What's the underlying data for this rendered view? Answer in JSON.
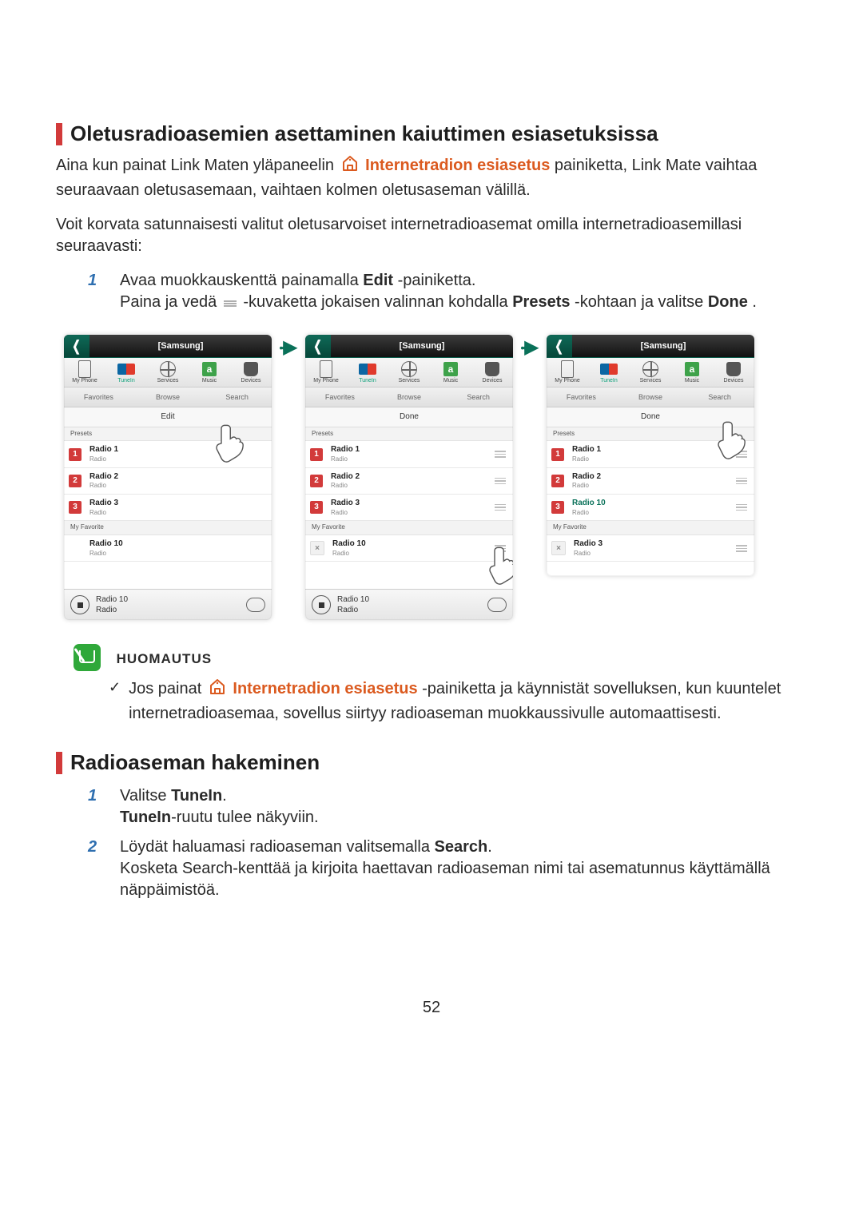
{
  "page_number": "52",
  "section1": {
    "heading": "Oletusradioasemien asettaminen kaiuttimen esiasetuksissa",
    "intro_part1": "Aina kun painat Link Maten yläpaneelin ",
    "intro_accent": "Internetradion esiasetus",
    "intro_part2": " painiketta, Link Mate vaihtaa seuraavaan oletusasemaan, vaihtaen kolmen oletusaseman välillä.",
    "intro2": "Voit korvata satunnaisesti valitut oletusarvoiset internetradioasemat omilla internetradioasemillasi seuraavasti:",
    "step1_num": "1",
    "step1_a_pre": "Avaa muokkauskenttä painamalla ",
    "step1_a_bold": "Edit",
    "step1_a_post": "-painiketta.",
    "step1_b_pre": "Paina ja vedä ",
    "step1_b_mid": " -kuvaketta jokaisen valinnan kohdalla ",
    "step1_b_bold1": "Presets",
    "step1_b_post1": "-kohtaan ja valitse ",
    "step1_b_bold2": "Done",
    "step1_b_post2": "."
  },
  "note": {
    "title": "HUOMAUTUS",
    "item_pre": "Jos painat ",
    "item_accent": "Internetradion esiasetus",
    "item_post": " -painiketta ja käynnistät sovelluksen, kun kuuntelet internetradioasemaa, sovellus siirtyy radioaseman muokkaussivulle automaattisesti."
  },
  "section2": {
    "heading": "Radioaseman hakeminen",
    "step1_num": "1",
    "step1_line1_pre": "Valitse ",
    "step1_line1_bold": "TuneIn",
    "step1_line1_post": ".",
    "step1_line2_bold": "TuneIn",
    "step1_line2_post": "-ruutu tulee näkyviin.",
    "step2_num": "2",
    "step2_line1_pre": "Löydät haluamasi radioaseman valitsemalla ",
    "step2_line1_bold": "Search",
    "step2_line1_post": ".",
    "step2_line2": "Kosketa Search-kenttää ja kirjoita haettavan radioaseman nimi tai asematunnus käyttämällä näppäimistöä."
  },
  "mock": {
    "header": "[Samsung]",
    "src": {
      "myphone": "My Phone",
      "tunein": "TuneIn",
      "services": "Services",
      "music": "Music",
      "devices": "Devices",
      "music_letter": "a"
    },
    "tabs": {
      "fav": "Favorites",
      "browse": "Browse",
      "search": "Search"
    },
    "edit_label": "Edit",
    "done_label": "Done",
    "presets_label": "Presets",
    "myfav_label": "My Favorite",
    "radio_sub": "Radio",
    "a_presets": [
      {
        "n": "1",
        "name": "Radio 1"
      },
      {
        "n": "2",
        "name": "Radio 2"
      },
      {
        "n": "3",
        "name": "Radio 3"
      }
    ],
    "a_fav": {
      "name": "Radio 10"
    },
    "a_now": {
      "name": "Radio 10"
    },
    "b_presets": [
      {
        "n": "1",
        "name": "Radio 1"
      },
      {
        "n": "2",
        "name": "Radio 2"
      },
      {
        "n": "3",
        "name": "Radio 3"
      }
    ],
    "b_fav": {
      "name": "Radio 10"
    },
    "b_now": {
      "name": "Radio 10"
    },
    "c_presets": [
      {
        "n": "1",
        "name": "Radio 1"
      },
      {
        "n": "2",
        "name": "Radio 2"
      },
      {
        "n": "3",
        "name": "Radio 10",
        "favorite": true
      }
    ],
    "c_fav": {
      "name": "Radio 3"
    }
  }
}
